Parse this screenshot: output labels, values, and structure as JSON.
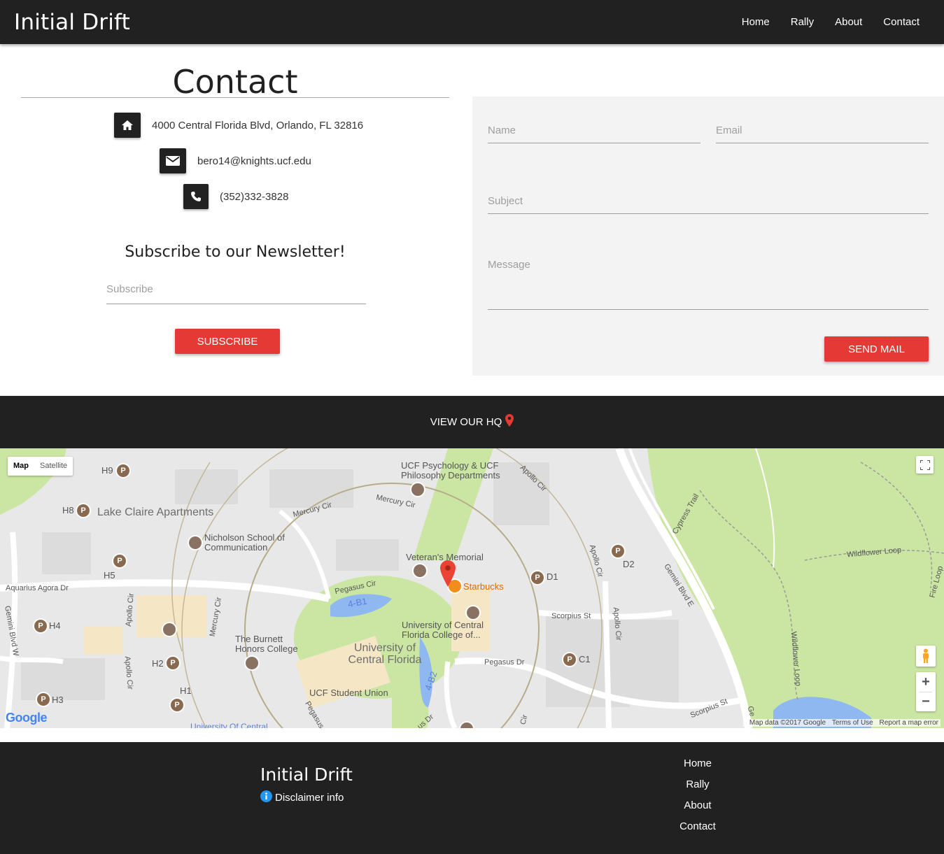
{
  "nav": {
    "brand": "Initial Drift",
    "links": [
      "Home",
      "Rally",
      "About",
      "Contact"
    ]
  },
  "contact": {
    "title": "Contact",
    "address": "4000 Central Florida Blvd, Orlando, FL 32816",
    "email": "bero14@knights.ucf.edu",
    "phone": "(352)332-3828",
    "icons": [
      "home-icon",
      "envelope-icon",
      "phone-icon"
    ]
  },
  "newsletter": {
    "title": "Subscribe to our Newsletter!",
    "placeholder": "Subscribe",
    "button": "SUBSCRIBE"
  },
  "form": {
    "name_placeholder": "Name",
    "email_placeholder": "Email",
    "subject_placeholder": "Subject",
    "message_placeholder": "Message",
    "button": "SEND MAIL"
  },
  "hq": {
    "label": "VIEW OUR HQ",
    "icon": "map-marker-icon"
  },
  "map": {
    "type_options": [
      "Map",
      "Satellite"
    ],
    "selected_type": "Map",
    "labels": {
      "lake_claire": "Lake Claire Apartments",
      "nicholson": "Nicholson School of Communication",
      "psychology": "UCF Psychology & UCF Philosophy Departments",
      "veterans": "Veteran's Memorial",
      "starbucks": "Starbucks",
      "ucf_college": "University of Central Florida College of...",
      "ucf": "University of Central Florida",
      "burnett": "The Burnett Honors College",
      "student_union": "UCF Student Union",
      "ucf_bottom": "University Of Central",
      "aquarius": "Aquarius Agora Dr",
      "pegasus_cir": "Pegasus Cir",
      "mercury_cir_1": "Mercury Cir",
      "mercury_cir_2": "Mercury Cir",
      "mercury_cir_3": "Mercury Cir",
      "apollo_cir_1": "Apollo Cir",
      "apollo_cir_2": "Apollo Cir",
      "apollo_cir_3": "Apollo Cir",
      "apollo_cir_4": "Apollo Cir",
      "apollo_cir_5": "Apollo Cir",
      "scorpius_st_1": "Scorpius St",
      "scorpius_st_2": "Scorpius St",
      "pegasus_dr": "Pegasus Dr",
      "gemini_blvd_e": "Gemini Blvd E",
      "gemini_blvd_w": "Gemini Blvd W",
      "cypress_trail": "Cypress Trail",
      "wildflower_loop_1": "Wildflower Loop",
      "wildflower_loop_2": "Wildflower Loop",
      "fire_loop": "Fire Loop",
      "lot_4b1": "4-B1",
      "lot_4b2": "4-B2",
      "pegasus_c": "Pegasus C",
      "us_dr": "us Dr",
      "cir_partial": "Cir",
      "ge_partial": "Ge"
    },
    "parking": [
      "H9",
      "H8",
      "H5",
      "H4",
      "H2",
      "H3",
      "H1",
      "D1",
      "D2",
      "C1"
    ],
    "parking_symbol": "P",
    "attribution": {
      "data": "Map data ©2017 Google",
      "terms": "Terms of Use",
      "report": "Report a map error"
    },
    "logo": "Google",
    "zoom_in": "+",
    "zoom_out": "−"
  },
  "footer": {
    "brand": "Initial Drift",
    "disclaimer": "Disclaimer info",
    "links": [
      "Home",
      "Rally",
      "About",
      "Contact"
    ]
  },
  "colors": {
    "dark": "#212121",
    "accent_red": "#e53935",
    "panel": "#f3f3f3",
    "info_blue": "#2196f3",
    "map_green": "#cbe6a3",
    "map_water": "#8fb8f0"
  }
}
